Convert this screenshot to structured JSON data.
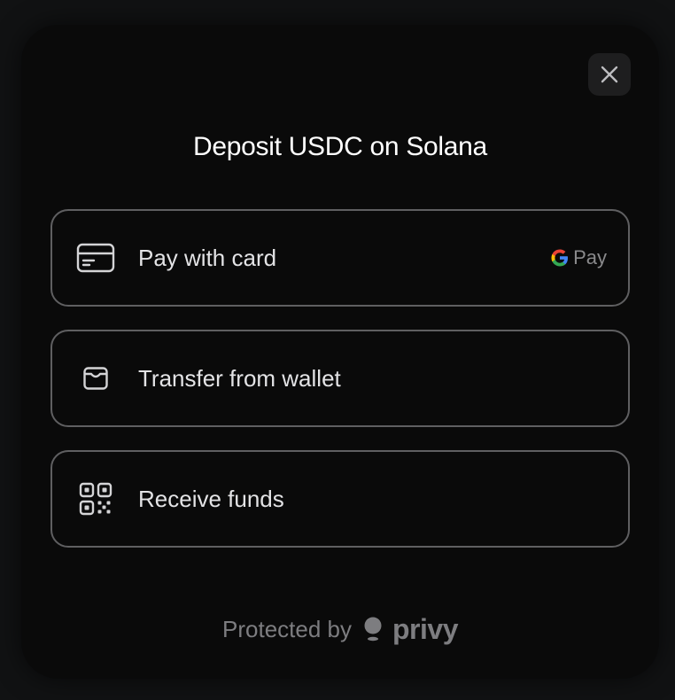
{
  "modal": {
    "title": "Deposit USDC on Solana",
    "close_icon": "close-icon"
  },
  "options": [
    {
      "label": "Pay with card",
      "icon": "credit-card-icon",
      "badge": {
        "g": "G",
        "text": "Pay",
        "icon": "google-g-icon"
      }
    },
    {
      "label": "Transfer from wallet",
      "icon": "wallet-icon"
    },
    {
      "label": "Receive funds",
      "icon": "qr-code-icon"
    }
  ],
  "footer": {
    "protected_text": "Protected by",
    "brand_name": "privy",
    "brand_icon": "privy-logo-icon"
  },
  "colors": {
    "background": "#111213",
    "modal_bg": "#0a0a0a",
    "border": "#5f5f61",
    "title": "#ffffff",
    "label": "#e3e3e5",
    "muted": "#7d7d80"
  }
}
